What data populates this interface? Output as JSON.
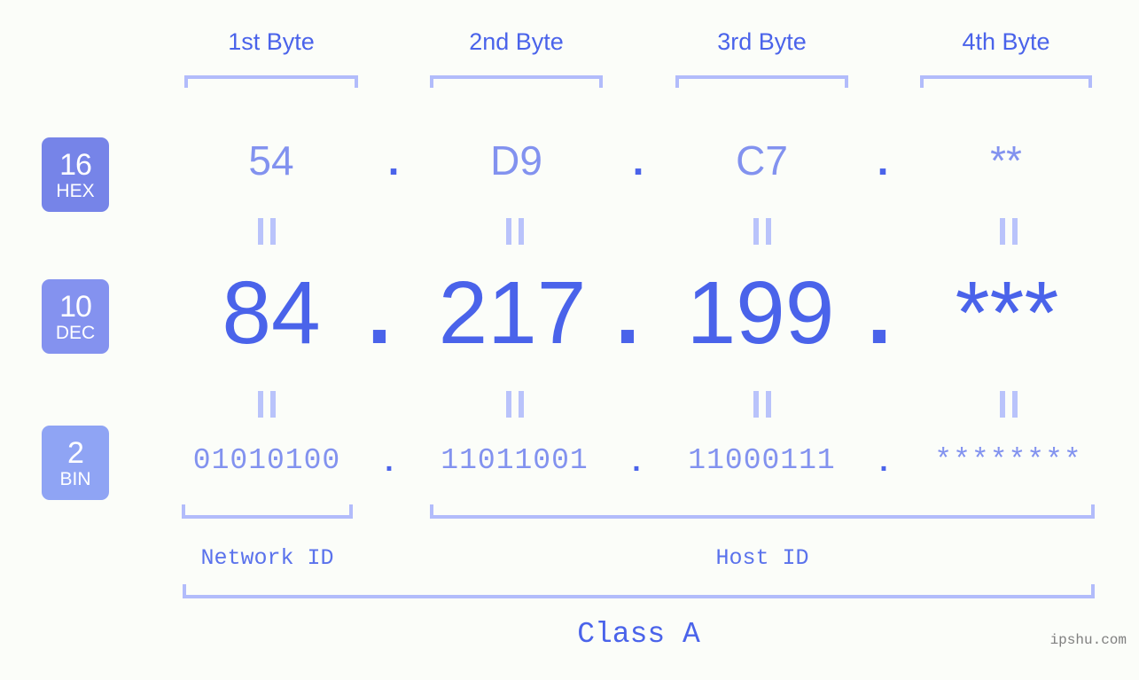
{
  "background_color": "#fbfdf9",
  "accent_colors": {
    "strong_blue": "#4a63ea",
    "mid_blue": "#8292ef",
    "light_blue": "#b2bcfb",
    "badge_hex": "#7684e8",
    "badge_dec": "#8492ef",
    "badge_bin": "#8fa4f4",
    "watermark_gray": "#7f7f7f"
  },
  "byte_headers": [
    {
      "label": "1st Byte"
    },
    {
      "label": "2nd Byte"
    },
    {
      "label": "3rd Byte"
    },
    {
      "label": "4th Byte"
    }
  ],
  "bases": [
    {
      "number": "16",
      "name": "HEX"
    },
    {
      "number": "10",
      "name": "DEC"
    },
    {
      "number": "2",
      "name": "BIN"
    }
  ],
  "rows": {
    "hex": {
      "base_number": "16",
      "base_name": "HEX",
      "values": [
        "54",
        "D9",
        "C7",
        "**"
      ],
      "separators": [
        ".",
        ".",
        "."
      ]
    },
    "dec": {
      "base_number": "10",
      "base_name": "DEC",
      "values": [
        "84",
        "217",
        "199",
        "***"
      ],
      "separators": [
        ".",
        ".",
        "."
      ]
    },
    "bin": {
      "base_number": "2",
      "base_name": "BIN",
      "values": [
        "01010100",
        "11011001",
        "11000111",
        "********"
      ],
      "separators": [
        ".",
        ".",
        "."
      ]
    }
  },
  "equals_marks": {
    "glyph": "||",
    "count_per_row": 4
  },
  "id_sections": [
    {
      "label": "Network ID"
    },
    {
      "label": "Host ID"
    }
  ],
  "class_label": "Class A",
  "watermark": "ipshu.com"
}
